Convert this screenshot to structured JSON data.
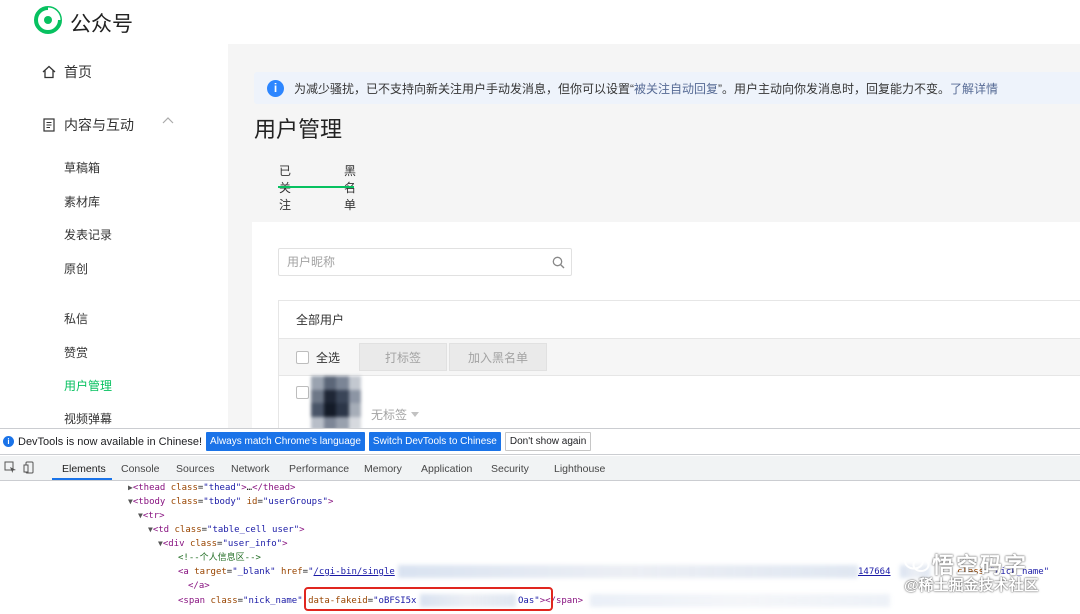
{
  "header": {
    "brand": "公众号"
  },
  "sidebar": {
    "home": "首页",
    "content_group": "内容与互动",
    "items": [
      "草稿箱",
      "素材库",
      "发表记录",
      "原创",
      "私信",
      "赞赏",
      "用户管理",
      "视频弹幕"
    ],
    "active_item": "用户管理"
  },
  "notice": {
    "text_before": "为减少骚扰，已不支持向新关注用户手动发消息，但你可以设置“",
    "link_auto_reply": "被关注自动回复",
    "text_after": "”。用户主动向你发消息时，回复能力不变。",
    "link_more": "了解详情"
  },
  "main": {
    "title": "用户管理",
    "tabs": [
      "已关注",
      "黑名单"
    ],
    "active_tab": "已关注",
    "search_placeholder": "用户昵称",
    "group_title": "全部用户",
    "select_all": "全选",
    "tag_button": "打标签",
    "blacklist_button": "加入黑名单",
    "user_tag": "无标签"
  },
  "devtools": {
    "banner_text": "DevTools is now available in Chinese!",
    "banner_btn_match": "Always match Chrome's language",
    "banner_btn_switch": "Switch DevTools to Chinese",
    "banner_btn_dismiss": "Don't show again",
    "tabs": [
      "Elements",
      "Console",
      "Sources",
      "Network",
      "Performance",
      "Memory",
      "Application",
      "Security",
      "Lighthouse"
    ],
    "active_tab": "Elements",
    "code": {
      "l1_tag": "thead",
      "l1_class": "thead",
      "l1_ellipsis": "…",
      "l2_tag": "tbody",
      "l2_class": "tbody",
      "l2_id": "userGroups",
      "l3_tag": "tr",
      "l4_tag": "td",
      "l4_class": "table_cell user",
      "l5_tag": "div",
      "l5_class": "user_info",
      "l6_comment": "<!--个人信息区-->",
      "l7_target": "_blank",
      "l7_href": "/cgi-bin/single",
      "l7_right_num": "147664",
      "l7_right_attr": "class",
      "l7_right_val": "nick_name",
      "l8_close": "</a>",
      "l9_class": "nick_name",
      "l9_attr": "data-fakeid",
      "l9_val_start": "oBFSI5x",
      "l9_val_end": "Oas",
      "l9_close": "</span>"
    }
  },
  "watermark": {
    "line1": "悟空码字",
    "line2": "@稀土掘金技术社区"
  },
  "colors": {
    "accent": "#07c160",
    "devtools_blue": "#1a73e8",
    "highlight_red": "#e0261f"
  }
}
